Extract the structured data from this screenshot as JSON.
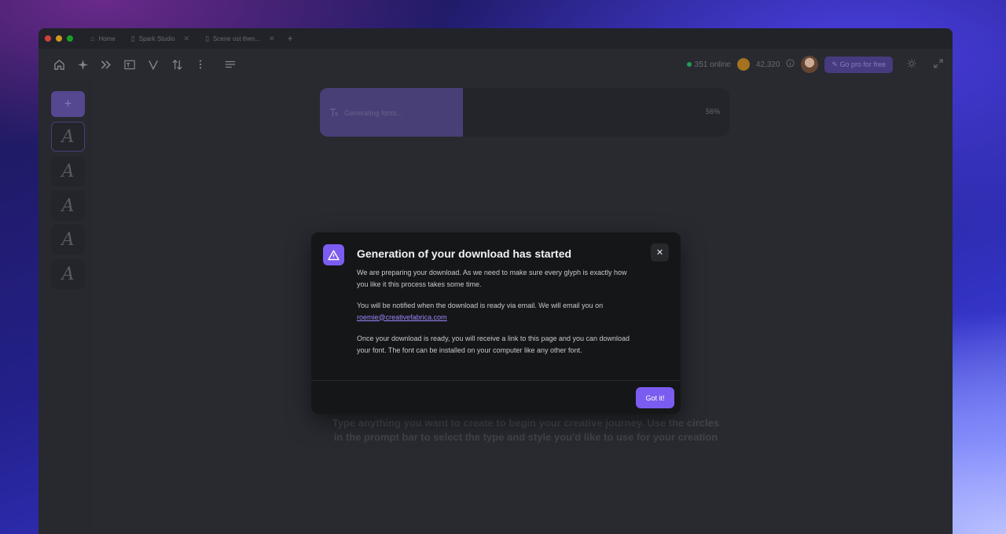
{
  "browser": {
    "tabs": [
      {
        "label": "Home",
        "icon": "home-icon"
      },
      {
        "label": "Spark Studio",
        "icon": "document-icon"
      },
      {
        "label": "Scene ost then...",
        "icon": "document-icon"
      }
    ],
    "new_tab": "+",
    "traffic_lights": [
      "#e0443e",
      "#dea123",
      "#1aab29"
    ]
  },
  "toolbar": {
    "online": "351 online",
    "credits": "42,320",
    "pro_button": "Go pro for free",
    "pro_icon": "sparkle-icon"
  },
  "sidebar": {
    "add_label": "+",
    "thumbnails": [
      "A",
      "A",
      "A",
      "A",
      "A"
    ]
  },
  "progress": {
    "label": "Generating fonts...",
    "percent_text": "56%",
    "value": 0.35
  },
  "hint": "Type anything you want to create to begin your creative journey. Use the circles in the prompt bar to select the type and style you'd like to use for your creation",
  "modal": {
    "title": "Generation of your download has started",
    "para1": "We are preparing your download. As we need to make sure every glyph is exactly how you like it this process takes some time.",
    "para2_text": "You will be notified when the download is ready via email. We will email you on",
    "email": "roemie@creativefabrica.com",
    "para3": "Once your download is ready, you will receive a link to this page and you can download your font. The font can be installed on your computer like any other font.",
    "close_label": "✕",
    "confirm_button": "Got it!"
  },
  "colors": {
    "accent": "#7b5cf0",
    "modal_bg": "#151618",
    "app_bg": "#2b2d33"
  }
}
